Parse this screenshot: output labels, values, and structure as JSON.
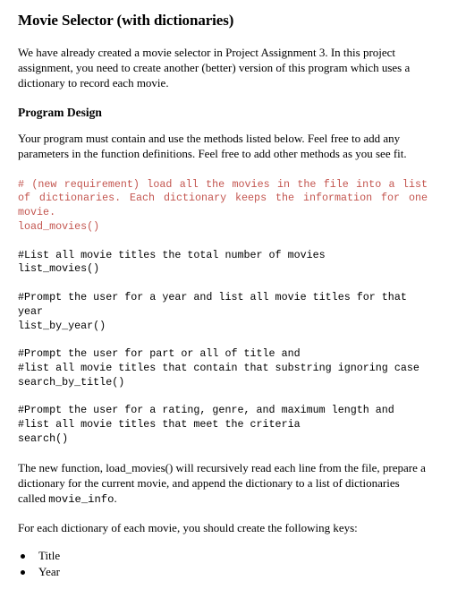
{
  "document": {
    "title": "Movie Selector (with dictionaries)",
    "intro_paragraph": "We have already created a movie selector in Project Assignment 3. In this project assignment, you need to create another (better) version of this program which uses a dictionary to record each movie.",
    "section_heading": "Program Design",
    "design_paragraph": "Your program must contain and use the methods listed below. Feel free to add any parameters in the function definitions. Feel free to add other methods as you see fit.",
    "closing_paragraph_part1": "The new function, load_movies() will recursively read each line from the file, prepare a dictionary for the current movie, and append the dictionary to a list of dictionaries called ",
    "closing_paragraph_code": "movie_info",
    "closing_paragraph_part2": ".",
    "keys_intro": "For each dictionary of each movie, you should create the following keys:"
  },
  "colors": {
    "page_background": "#ffffff",
    "body_text": "#000000",
    "accent_code": "#c3554f"
  },
  "code_blocks": [
    {
      "id": "load-movies",
      "accent": true,
      "comment": "# (new requirement) load all the movies in the file into a list of dictionaries. Each dictionary keeps the information for one movie.",
      "call": "load_movies()"
    },
    {
      "id": "list-movies",
      "accent": false,
      "comment": "#List all movie titles the total number of movies",
      "call": "list_movies()"
    },
    {
      "id": "list-by-year",
      "accent": false,
      "comment": "#Prompt the user for a year and list all movie titles for that year",
      "call": "list_by_year()"
    },
    {
      "id": "search-by-title",
      "accent": false,
      "comment": "#Prompt the user for part or all of title and\n#list all movie titles that contain that substring ignoring case",
      "call": "search_by_title()"
    },
    {
      "id": "search",
      "accent": false,
      "comment": "#Prompt the user for a rating, genre, and maximum length and\n#list all movie titles that meet the criteria",
      "call": "search()"
    }
  ],
  "key_list": [
    {
      "label": "Title"
    },
    {
      "label": "Year"
    }
  ]
}
